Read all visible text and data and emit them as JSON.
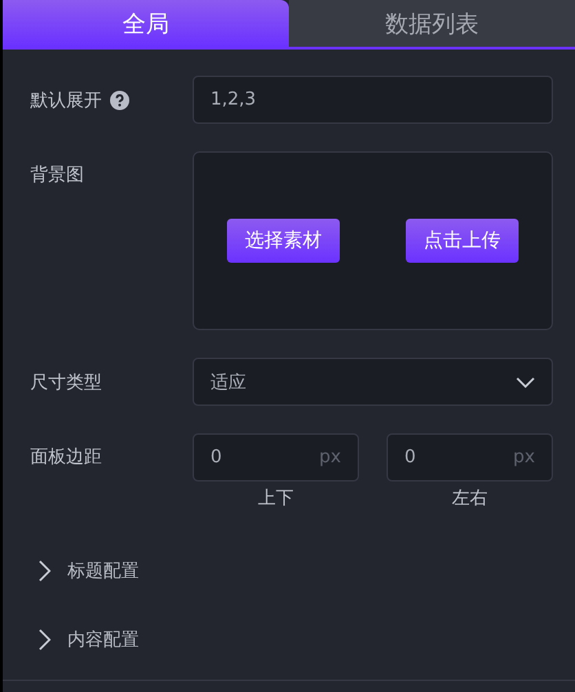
{
  "tabs": [
    {
      "label": "全局",
      "selected": true
    },
    {
      "label": "数据列表",
      "selected": false
    }
  ],
  "default_expand": {
    "label": "默认展开",
    "help": true,
    "value": "1,2,3"
  },
  "background_image": {
    "label": "背景图",
    "buttons": [
      "选择素材",
      "点击上传"
    ]
  },
  "size_type": {
    "label": "尺寸类型",
    "value": "适应"
  },
  "panel_padding": {
    "label": "面板边距",
    "fields": [
      {
        "value": "0",
        "unit": "px",
        "caption": "上下"
      },
      {
        "value": "0",
        "unit": "px",
        "caption": "左右"
      }
    ]
  },
  "sections": [
    {
      "label": "标题配置",
      "expanded": false
    },
    {
      "label": "内容配置",
      "expanded": false
    }
  ]
}
